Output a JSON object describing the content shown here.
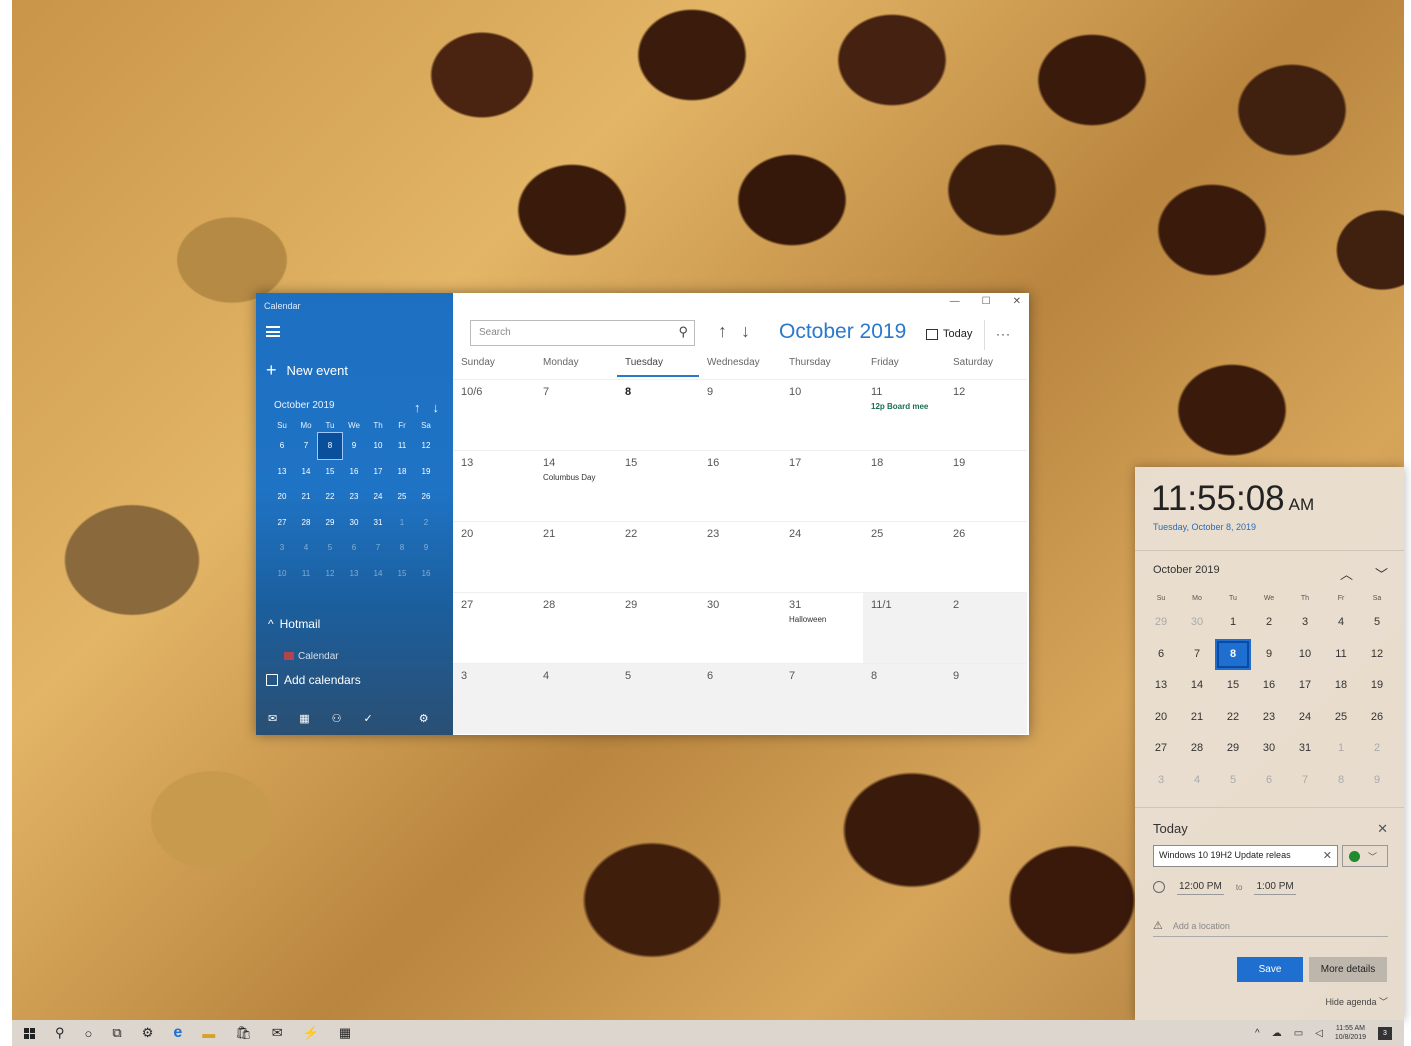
{
  "calendar": {
    "app_title": "Calendar",
    "new_event": "New event",
    "mini": {
      "month": "October 2019",
      "dow": [
        "Su",
        "Mo",
        "Tu",
        "We",
        "Th",
        "Fr",
        "Sa"
      ],
      "days": [
        [
          "6",
          "7",
          "8",
          "9",
          "10",
          "11",
          "12"
        ],
        [
          "13",
          "14",
          "15",
          "16",
          "17",
          "18",
          "19"
        ],
        [
          "20",
          "21",
          "22",
          "23",
          "24",
          "25",
          "26"
        ],
        [
          "27",
          "28",
          "29",
          "30",
          "31",
          "1",
          "2"
        ],
        [
          "3",
          "4",
          "5",
          "6",
          "7",
          "8",
          "9"
        ],
        [
          "10",
          "11",
          "12",
          "13",
          "14",
          "15",
          "16"
        ]
      ],
      "selected": "8"
    },
    "hotmail": "Hotmail",
    "calendar_item": "Calendar",
    "add_calendars": "Add calendars",
    "search_placeholder": "Search",
    "month_title": "October 2019",
    "today": "Today",
    "more": "···",
    "dow": [
      "Sunday",
      "Monday",
      "Tuesday",
      "Wednesday",
      "Thursday",
      "Friday",
      "Saturday"
    ],
    "weeks": [
      [
        {
          "d": "10/6"
        },
        {
          "d": "7"
        },
        {
          "d": "8"
        },
        {
          "d": "9"
        },
        {
          "d": "10"
        },
        {
          "d": "11",
          "ev": "12p Board mee"
        },
        {
          "d": "12"
        }
      ],
      [
        {
          "d": "13"
        },
        {
          "d": "14",
          "ev": "Columbus Day"
        },
        {
          "d": "15"
        },
        {
          "d": "16"
        },
        {
          "d": "17"
        },
        {
          "d": "18"
        },
        {
          "d": "19"
        }
      ],
      [
        {
          "d": "20"
        },
        {
          "d": "21"
        },
        {
          "d": "22"
        },
        {
          "d": "23"
        },
        {
          "d": "24"
        },
        {
          "d": "25"
        },
        {
          "d": "26"
        }
      ],
      [
        {
          "d": "27"
        },
        {
          "d": "28"
        },
        {
          "d": "29"
        },
        {
          "d": "30"
        },
        {
          "d": "31",
          "ev": "Halloween"
        },
        {
          "d": "11/1"
        },
        {
          "d": "2"
        }
      ],
      [
        {
          "d": "3"
        },
        {
          "d": "4"
        },
        {
          "d": "5"
        },
        {
          "d": "6"
        },
        {
          "d": "7"
        },
        {
          "d": "8"
        },
        {
          "d": "9"
        }
      ]
    ]
  },
  "flyout": {
    "time": "11:55:08",
    "ampm": "AM",
    "date": "Tuesday, October 8, 2019",
    "month": "October 2019",
    "dow": [
      "Su",
      "Mo",
      "Tu",
      "We",
      "Th",
      "Fr",
      "Sa"
    ],
    "days": [
      [
        "29",
        "30",
        "1",
        "2",
        "3",
        "4",
        "5"
      ],
      [
        "6",
        "7",
        "8",
        "9",
        "10",
        "11",
        "12"
      ],
      [
        "13",
        "14",
        "15",
        "16",
        "17",
        "18",
        "19"
      ],
      [
        "20",
        "21",
        "22",
        "23",
        "24",
        "25",
        "26"
      ],
      [
        "27",
        "28",
        "29",
        "30",
        "31",
        "1",
        "2"
      ],
      [
        "3",
        "4",
        "5",
        "6",
        "7",
        "8",
        "9"
      ]
    ],
    "selected": "8",
    "agenda_title": "Today",
    "event_text": "Windows 10 19H2 Update releas",
    "start": "12:00 PM",
    "to": "to",
    "end": "1:00 PM",
    "location_placeholder": "Add a location",
    "save": "Save",
    "more_details": "More details",
    "hide_agenda": "Hide agenda"
  },
  "tray": {
    "time": "11:55 AM",
    "date": "10/8/2019",
    "notif": "3"
  }
}
